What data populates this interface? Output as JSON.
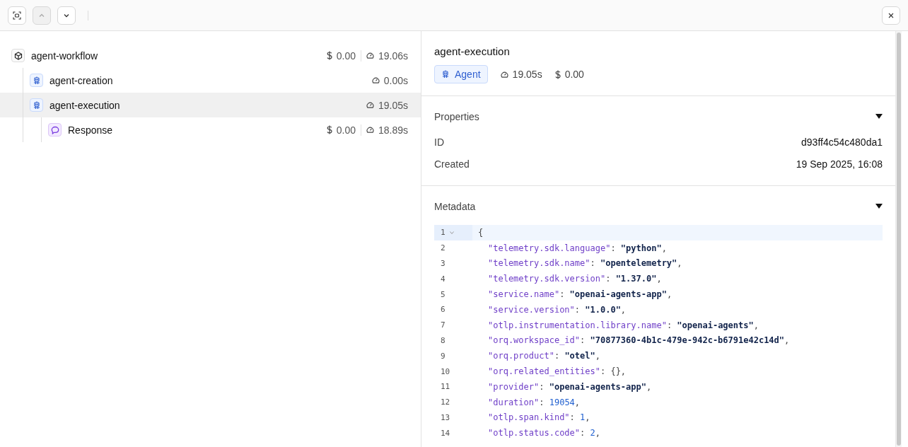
{
  "toolbar": {
    "buttons": [
      {
        "kind": "focus",
        "disabled": false
      },
      {
        "kind": "up",
        "disabled": true
      },
      {
        "kind": "down",
        "disabled": false
      }
    ]
  },
  "tree": [
    {
      "kind": "workflow",
      "name": "agent-workflow",
      "cost": "0.00",
      "duration": "19.06s",
      "selected": false,
      "children": [
        {
          "kind": "agent",
          "name": "agent-creation",
          "duration": "0.00s",
          "selected": false
        },
        {
          "kind": "agent",
          "name": "agent-execution",
          "duration": "19.05s",
          "selected": true,
          "children": [
            {
              "kind": "response",
              "name": "Response",
              "cost": "0.00",
              "duration": "18.89s",
              "selected": false
            }
          ]
        }
      ]
    }
  ],
  "detail": {
    "title": "agent-execution",
    "badge": "Agent",
    "duration": "19.05s",
    "cost": "0.00",
    "properties": {
      "title": "Properties",
      "expanded": true,
      "rows": [
        {
          "label": "ID",
          "value": "d93ff4c54c480da1"
        },
        {
          "label": "Created",
          "value": "19 Sep 2025, 16:08"
        }
      ]
    },
    "metadata": {
      "title": "Metadata",
      "expanded": true,
      "lines": [
        {
          "number": "1",
          "active": true,
          "foldable": true,
          "tokens": [
            {
              "kind": "punct",
              "text": "{"
            }
          ]
        },
        {
          "number": "2",
          "active": false,
          "foldable": false,
          "tokens": [
            {
              "kind": "key",
              "text": "\"telemetry.sdk.language\""
            },
            {
              "kind": "punct",
              "text": ": "
            },
            {
              "kind": "string",
              "text": "\"python\""
            },
            {
              "kind": "punct",
              "text": ","
            }
          ]
        },
        {
          "number": "3",
          "active": false,
          "foldable": false,
          "tokens": [
            {
              "kind": "key",
              "text": "\"telemetry.sdk.name\""
            },
            {
              "kind": "punct",
              "text": ": "
            },
            {
              "kind": "string",
              "text": "\"opentelemetry\""
            },
            {
              "kind": "punct",
              "text": ","
            }
          ]
        },
        {
          "number": "4",
          "active": false,
          "foldable": false,
          "tokens": [
            {
              "kind": "key",
              "text": "\"telemetry.sdk.version\""
            },
            {
              "kind": "punct",
              "text": ": "
            },
            {
              "kind": "string",
              "text": "\"1.37.0\""
            },
            {
              "kind": "punct",
              "text": ","
            }
          ]
        },
        {
          "number": "5",
          "active": false,
          "foldable": false,
          "tokens": [
            {
              "kind": "key",
              "text": "\"service.name\""
            },
            {
              "kind": "punct",
              "text": ": "
            },
            {
              "kind": "string",
              "text": "\"openai-agents-app\""
            },
            {
              "kind": "punct",
              "text": ","
            }
          ]
        },
        {
          "number": "6",
          "active": false,
          "foldable": false,
          "tokens": [
            {
              "kind": "key",
              "text": "\"service.version\""
            },
            {
              "kind": "punct",
              "text": ": "
            },
            {
              "kind": "string",
              "text": "\"1.0.0\""
            },
            {
              "kind": "punct",
              "text": ","
            }
          ]
        },
        {
          "number": "7",
          "active": false,
          "foldable": false,
          "tokens": [
            {
              "kind": "key",
              "text": "\"otlp.instrumentation.library.name\""
            },
            {
              "kind": "punct",
              "text": ": "
            },
            {
              "kind": "string",
              "text": "\"openai-agents\""
            },
            {
              "kind": "punct",
              "text": ","
            }
          ]
        },
        {
          "number": "8",
          "active": false,
          "foldable": false,
          "tokens": [
            {
              "kind": "key",
              "text": "\"orq.workspace_id\""
            },
            {
              "kind": "punct",
              "text": ": "
            },
            {
              "kind": "string",
              "text": "\"70877360-4b1c-479e-942c-b6791e42c14d\""
            },
            {
              "kind": "punct",
              "text": ","
            }
          ]
        },
        {
          "number": "9",
          "active": false,
          "foldable": false,
          "tokens": [
            {
              "kind": "key",
              "text": "\"orq.product\""
            },
            {
              "kind": "punct",
              "text": ": "
            },
            {
              "kind": "string",
              "text": "\"otel\""
            },
            {
              "kind": "punct",
              "text": ","
            }
          ]
        },
        {
          "number": "10",
          "active": false,
          "foldable": false,
          "tokens": [
            {
              "kind": "key",
              "text": "\"orq.related_entities\""
            },
            {
              "kind": "punct",
              "text": ": {},"
            }
          ]
        },
        {
          "number": "11",
          "active": false,
          "foldable": false,
          "tokens": [
            {
              "kind": "key",
              "text": "\"provider\""
            },
            {
              "kind": "punct",
              "text": ": "
            },
            {
              "kind": "string",
              "text": "\"openai-agents-app\""
            },
            {
              "kind": "punct",
              "text": ","
            }
          ]
        },
        {
          "number": "12",
          "active": false,
          "foldable": false,
          "tokens": [
            {
              "kind": "key",
              "text": "\"duration\""
            },
            {
              "kind": "punct",
              "text": ": "
            },
            {
              "kind": "number",
              "text": "19054"
            },
            {
              "kind": "punct",
              "text": ","
            }
          ]
        },
        {
          "number": "13",
          "active": false,
          "foldable": false,
          "tokens": [
            {
              "kind": "key",
              "text": "\"otlp.span.kind\""
            },
            {
              "kind": "punct",
              "text": ": "
            },
            {
              "kind": "number",
              "text": "1"
            },
            {
              "kind": "punct",
              "text": ","
            }
          ]
        },
        {
          "number": "14",
          "active": false,
          "foldable": false,
          "tokens": [
            {
              "kind": "key",
              "text": "\"otlp.status.code\""
            },
            {
              "kind": "punct",
              "text": ": "
            },
            {
              "kind": "number",
              "text": "2"
            },
            {
              "kind": "punct",
              "text": ","
            }
          ]
        }
      ]
    }
  }
}
